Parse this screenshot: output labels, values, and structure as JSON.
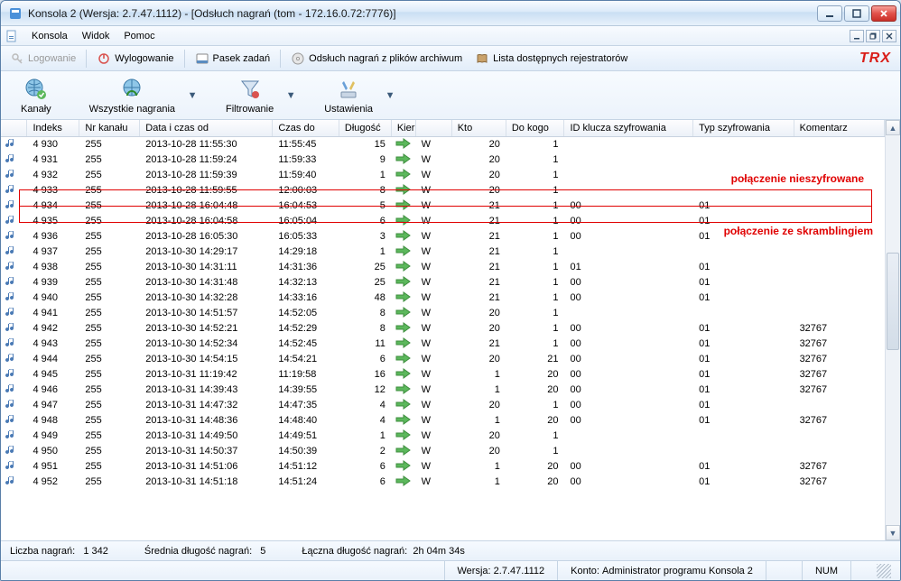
{
  "window": {
    "title": "Konsola 2 (Wersja:  2.7.47.1112) - [Odsłuch nagrań (tom - 172.16.0.72:7776)]"
  },
  "menu": {
    "items": [
      "Konsola",
      "Widok",
      "Pomoc"
    ]
  },
  "toolbar1": {
    "login": "Logowanie",
    "logout": "Wylogowanie",
    "taskbar": "Pasek zadań",
    "archive": "Odsłuch nagrań z plików archiwum",
    "recorders": "Lista dostępnych rejestratorów",
    "brand": "TRX"
  },
  "toolbar2": {
    "channels": "Kanały",
    "all_recordings": "Wszystkie nagrania",
    "filter": "Filtrowanie",
    "settings": "Ustawienia"
  },
  "columns": [
    "",
    "Indeks",
    "Nr kanału",
    "Data i czas od",
    "Czas do",
    "Długość",
    "Kierunek",
    "",
    "Kto",
    "Do kogo",
    "ID klucza szyfrowania",
    "Typ szyfrowania",
    "Komentarz"
  ],
  "rows": [
    {
      "idx": "4 930",
      "ch": "255",
      "from": "2013-10-28 11:55:30",
      "to": "11:55:45",
      "len": "15",
      "dir": "W",
      "who": "20",
      "towho": "1",
      "key": "",
      "enc": "",
      "comment": ""
    },
    {
      "idx": "4 931",
      "ch": "255",
      "from": "2013-10-28 11:59:24",
      "to": "11:59:33",
      "len": "9",
      "dir": "W",
      "who": "20",
      "towho": "1",
      "key": "",
      "enc": "",
      "comment": ""
    },
    {
      "idx": "4 932",
      "ch": "255",
      "from": "2013-10-28 11:59:39",
      "to": "11:59:40",
      "len": "1",
      "dir": "W",
      "who": "20",
      "towho": "1",
      "key": "",
      "enc": "",
      "comment": ""
    },
    {
      "idx": "4 933",
      "ch": "255",
      "from": "2013-10-28 11:59:55",
      "to": "12:00:03",
      "len": "8",
      "dir": "W",
      "who": "20",
      "towho": "1",
      "key": "",
      "enc": "",
      "comment": ""
    },
    {
      "idx": "4 934",
      "ch": "255",
      "from": "2013-10-28 16:04:48",
      "to": "16:04:53",
      "len": "5",
      "dir": "W",
      "who": "21",
      "towho": "1",
      "key": "00",
      "enc": "01",
      "comment": ""
    },
    {
      "idx": "4 935",
      "ch": "255",
      "from": "2013-10-28 16:04:58",
      "to": "16:05:04",
      "len": "6",
      "dir": "W",
      "who": "21",
      "towho": "1",
      "key": "00",
      "enc": "01",
      "comment": ""
    },
    {
      "idx": "4 936",
      "ch": "255",
      "from": "2013-10-28 16:05:30",
      "to": "16:05:33",
      "len": "3",
      "dir": "W",
      "who": "21",
      "towho": "1",
      "key": "00",
      "enc": "01",
      "comment": ""
    },
    {
      "idx": "4 937",
      "ch": "255",
      "from": "2013-10-30 14:29:17",
      "to": "14:29:18",
      "len": "1",
      "dir": "W",
      "who": "21",
      "towho": "1",
      "key": "",
      "enc": "",
      "comment": ""
    },
    {
      "idx": "4 938",
      "ch": "255",
      "from": "2013-10-30 14:31:11",
      "to": "14:31:36",
      "len": "25",
      "dir": "W",
      "who": "21",
      "towho": "1",
      "key": "01",
      "enc": "01",
      "comment": ""
    },
    {
      "idx": "4 939",
      "ch": "255",
      "from": "2013-10-30 14:31:48",
      "to": "14:32:13",
      "len": "25",
      "dir": "W",
      "who": "21",
      "towho": "1",
      "key": "00",
      "enc": "01",
      "comment": ""
    },
    {
      "idx": "4 940",
      "ch": "255",
      "from": "2013-10-30 14:32:28",
      "to": "14:33:16",
      "len": "48",
      "dir": "W",
      "who": "21",
      "towho": "1",
      "key": "00",
      "enc": "01",
      "comment": ""
    },
    {
      "idx": "4 941",
      "ch": "255",
      "from": "2013-10-30 14:51:57",
      "to": "14:52:05",
      "len": "8",
      "dir": "W",
      "who": "20",
      "towho": "1",
      "key": "",
      "enc": "",
      "comment": ""
    },
    {
      "idx": "4 942",
      "ch": "255",
      "from": "2013-10-30 14:52:21",
      "to": "14:52:29",
      "len": "8",
      "dir": "W",
      "who": "20",
      "towho": "1",
      "key": "00",
      "enc": "01",
      "comment": "32767"
    },
    {
      "idx": "4 943",
      "ch": "255",
      "from": "2013-10-30 14:52:34",
      "to": "14:52:45",
      "len": "11",
      "dir": "W",
      "who": "21",
      "towho": "1",
      "key": "00",
      "enc": "01",
      "comment": "32767"
    },
    {
      "idx": "4 944",
      "ch": "255",
      "from": "2013-10-30 14:54:15",
      "to": "14:54:21",
      "len": "6",
      "dir": "W",
      "who": "20",
      "towho": "21",
      "key": "00",
      "enc": "01",
      "comment": "32767"
    },
    {
      "idx": "4 945",
      "ch": "255",
      "from": "2013-10-31 11:19:42",
      "to": "11:19:58",
      "len": "16",
      "dir": "W",
      "who": "1",
      "towho": "20",
      "key": "00",
      "enc": "01",
      "comment": "32767"
    },
    {
      "idx": "4 946",
      "ch": "255",
      "from": "2013-10-31 14:39:43",
      "to": "14:39:55",
      "len": "12",
      "dir": "W",
      "who": "1",
      "towho": "20",
      "key": "00",
      "enc": "01",
      "comment": "32767"
    },
    {
      "idx": "4 947",
      "ch": "255",
      "from": "2013-10-31 14:47:32",
      "to": "14:47:35",
      "len": "4",
      "dir": "W",
      "who": "20",
      "towho": "1",
      "key": "00",
      "enc": "01",
      "comment": ""
    },
    {
      "idx": "4 948",
      "ch": "255",
      "from": "2013-10-31 14:48:36",
      "to": "14:48:40",
      "len": "4",
      "dir": "W",
      "who": "1",
      "towho": "20",
      "key": "00",
      "enc": "01",
      "comment": "32767"
    },
    {
      "idx": "4 949",
      "ch": "255",
      "from": "2013-10-31 14:49:50",
      "to": "14:49:51",
      "len": "1",
      "dir": "W",
      "who": "20",
      "towho": "1",
      "key": "",
      "enc": "",
      "comment": ""
    },
    {
      "idx": "4 950",
      "ch": "255",
      "from": "2013-10-31 14:50:37",
      "to": "14:50:39",
      "len": "2",
      "dir": "W",
      "who": "20",
      "towho": "1",
      "key": "",
      "enc": "",
      "comment": ""
    },
    {
      "idx": "4 951",
      "ch": "255",
      "from": "2013-10-31 14:51:06",
      "to": "14:51:12",
      "len": "6",
      "dir": "W",
      "who": "1",
      "towho": "20",
      "key": "00",
      "enc": "01",
      "comment": "32767"
    },
    {
      "idx": "4 952",
      "ch": "255",
      "from": "2013-10-31 14:51:18",
      "to": "14:51:24",
      "len": "6",
      "dir": "W",
      "who": "1",
      "towho": "20",
      "key": "00",
      "enc": "01",
      "comment": "32767"
    }
  ],
  "annotations": {
    "unencrypted": "połączenie nieszyfrowane",
    "scrambling": "połączenie ze skramblingiem"
  },
  "status1": {
    "count_label": "Liczba nagrań:",
    "count_value": "1 342",
    "avg_label": "Średnia długość nagrań:",
    "avg_value": "5",
    "total_label": "Łączna długość nagrań:",
    "total_value": "2h 04m 34s"
  },
  "status2": {
    "version_label": "Wersja:",
    "version_value": "2.7.47.1112",
    "account_label": "Konto:",
    "account_value": "Administrator programu Konsola 2",
    "num": "NUM"
  }
}
